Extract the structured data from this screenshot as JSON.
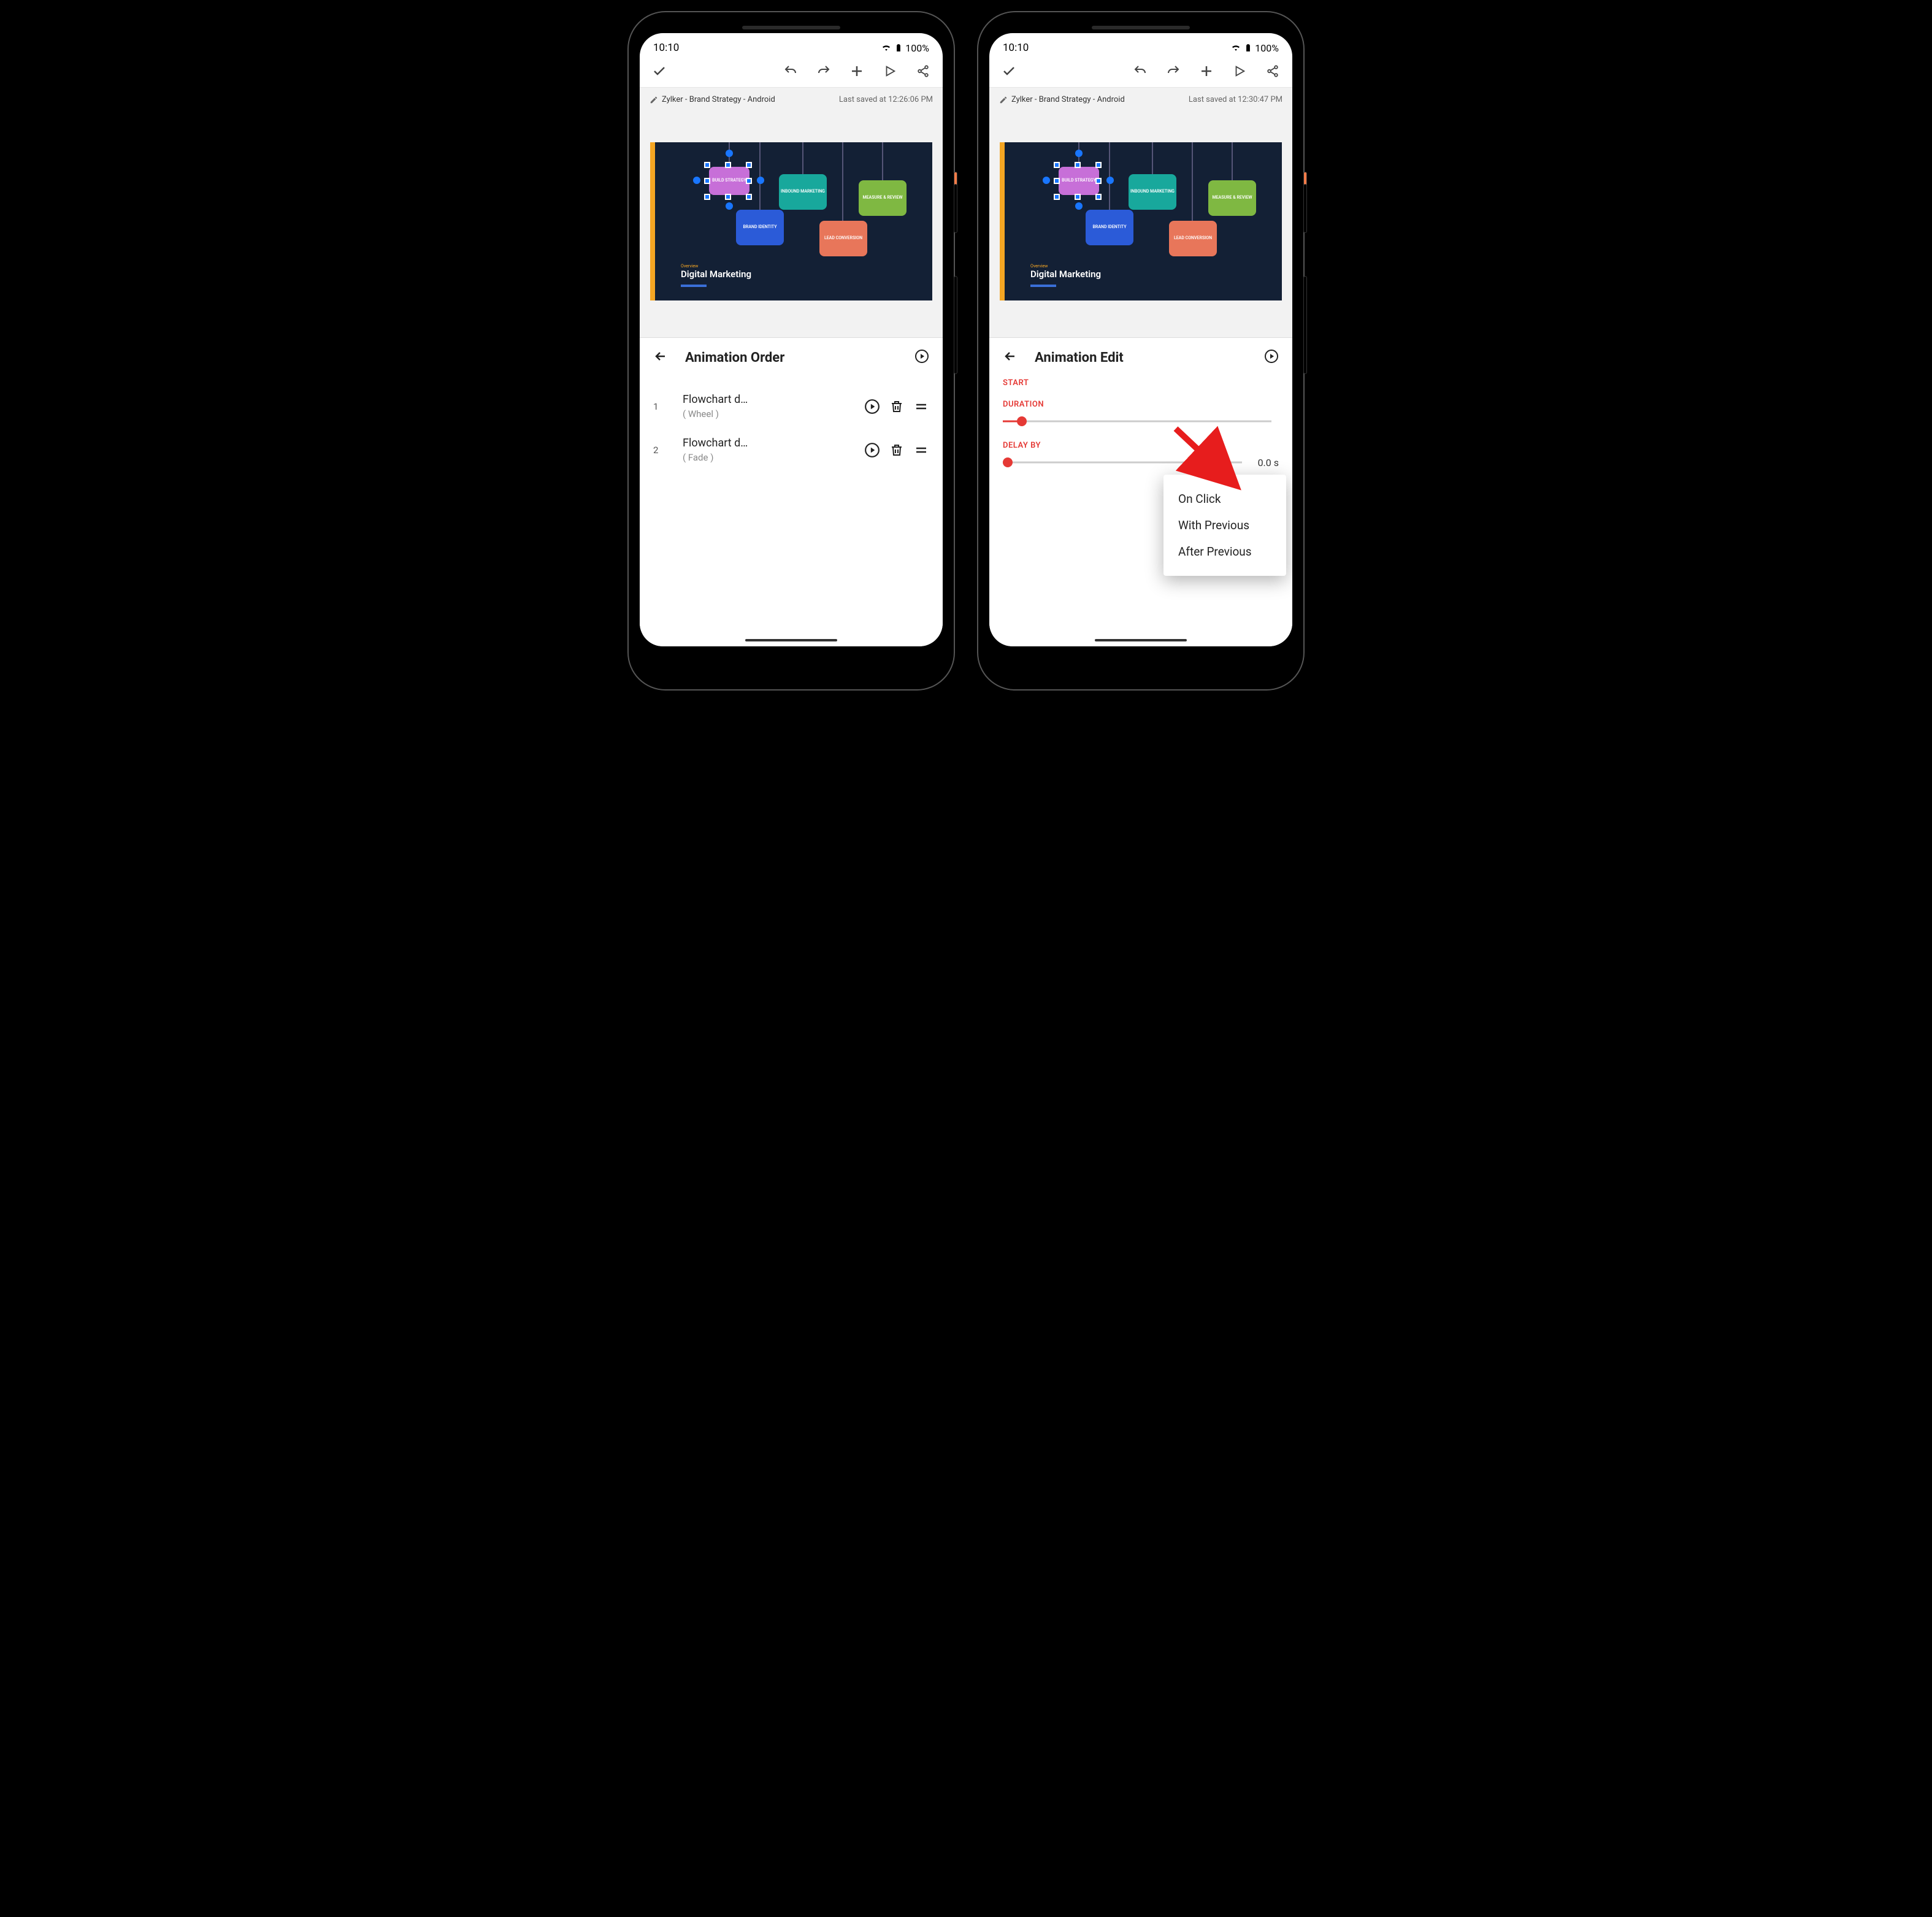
{
  "status": {
    "time": "10:10",
    "battery": "100%"
  },
  "doc_left": {
    "title": "Zylker - Brand Strategy - Android",
    "saved": "Last saved at 12:26:06 PM"
  },
  "doc_right": {
    "title": "Zylker - Brand Strategy - Android",
    "saved": "Last saved at 12:30:47 PM"
  },
  "slide": {
    "overline": "Overview",
    "title": "Digital Marketing",
    "shapes": {
      "build": "BUILD STRATEGY",
      "inbound": "INBOUND MARKETING",
      "measure": "MEASURE & REVIEW",
      "brand": "BRAND IDENTITY",
      "lead": "LEAD CONVERSION"
    }
  },
  "panel_order": {
    "title": "Animation Order",
    "items": [
      {
        "idx": "1",
        "name": "Flowchart d…",
        "sub": "( Wheel )"
      },
      {
        "idx": "2",
        "name": "Flowchart d…",
        "sub": "( Fade )"
      }
    ]
  },
  "panel_edit": {
    "title": "Animation Edit",
    "start_label": "START",
    "duration_label": "DURATION",
    "delay_label": "DELAY BY",
    "delay_value": "0.0 s",
    "popup": [
      "On Click",
      "With Previous",
      "After Previous"
    ]
  }
}
